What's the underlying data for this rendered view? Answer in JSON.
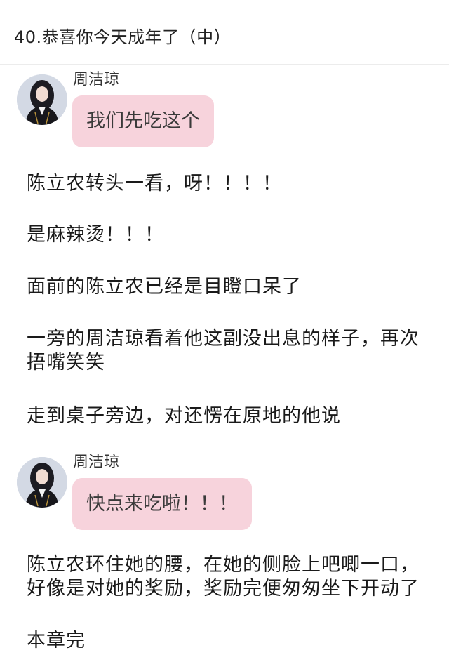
{
  "header": {
    "title": "40.恭喜你今天成年了（中）"
  },
  "messages": [
    {
      "speaker": "周洁琼",
      "text": "我们先吃这个"
    },
    {
      "speaker": "周洁琼",
      "text": "快点来吃啦！！！"
    }
  ],
  "paragraphs": [
    "陈立农转头一看，呀！！！！",
    "是麻辣烫！！！",
    "面前的陈立农已经是目瞪口呆了",
    "一旁的周洁琼看着他这副没出息的样子，再次捂嘴笑笑",
    "走到桌子旁边，对还愣在原地的他说",
    "陈立农环住她的腰，在她的侧脸上吧唧一口，好像是对她的奖励，奖励完便匆匆坐下开动了",
    "本章完"
  ],
  "colors": {
    "bubble": "#f7d3dc",
    "text": "#1a1a1a",
    "divider": "#ececec"
  },
  "icons": {
    "avatar": "profile-photo-avatar"
  }
}
